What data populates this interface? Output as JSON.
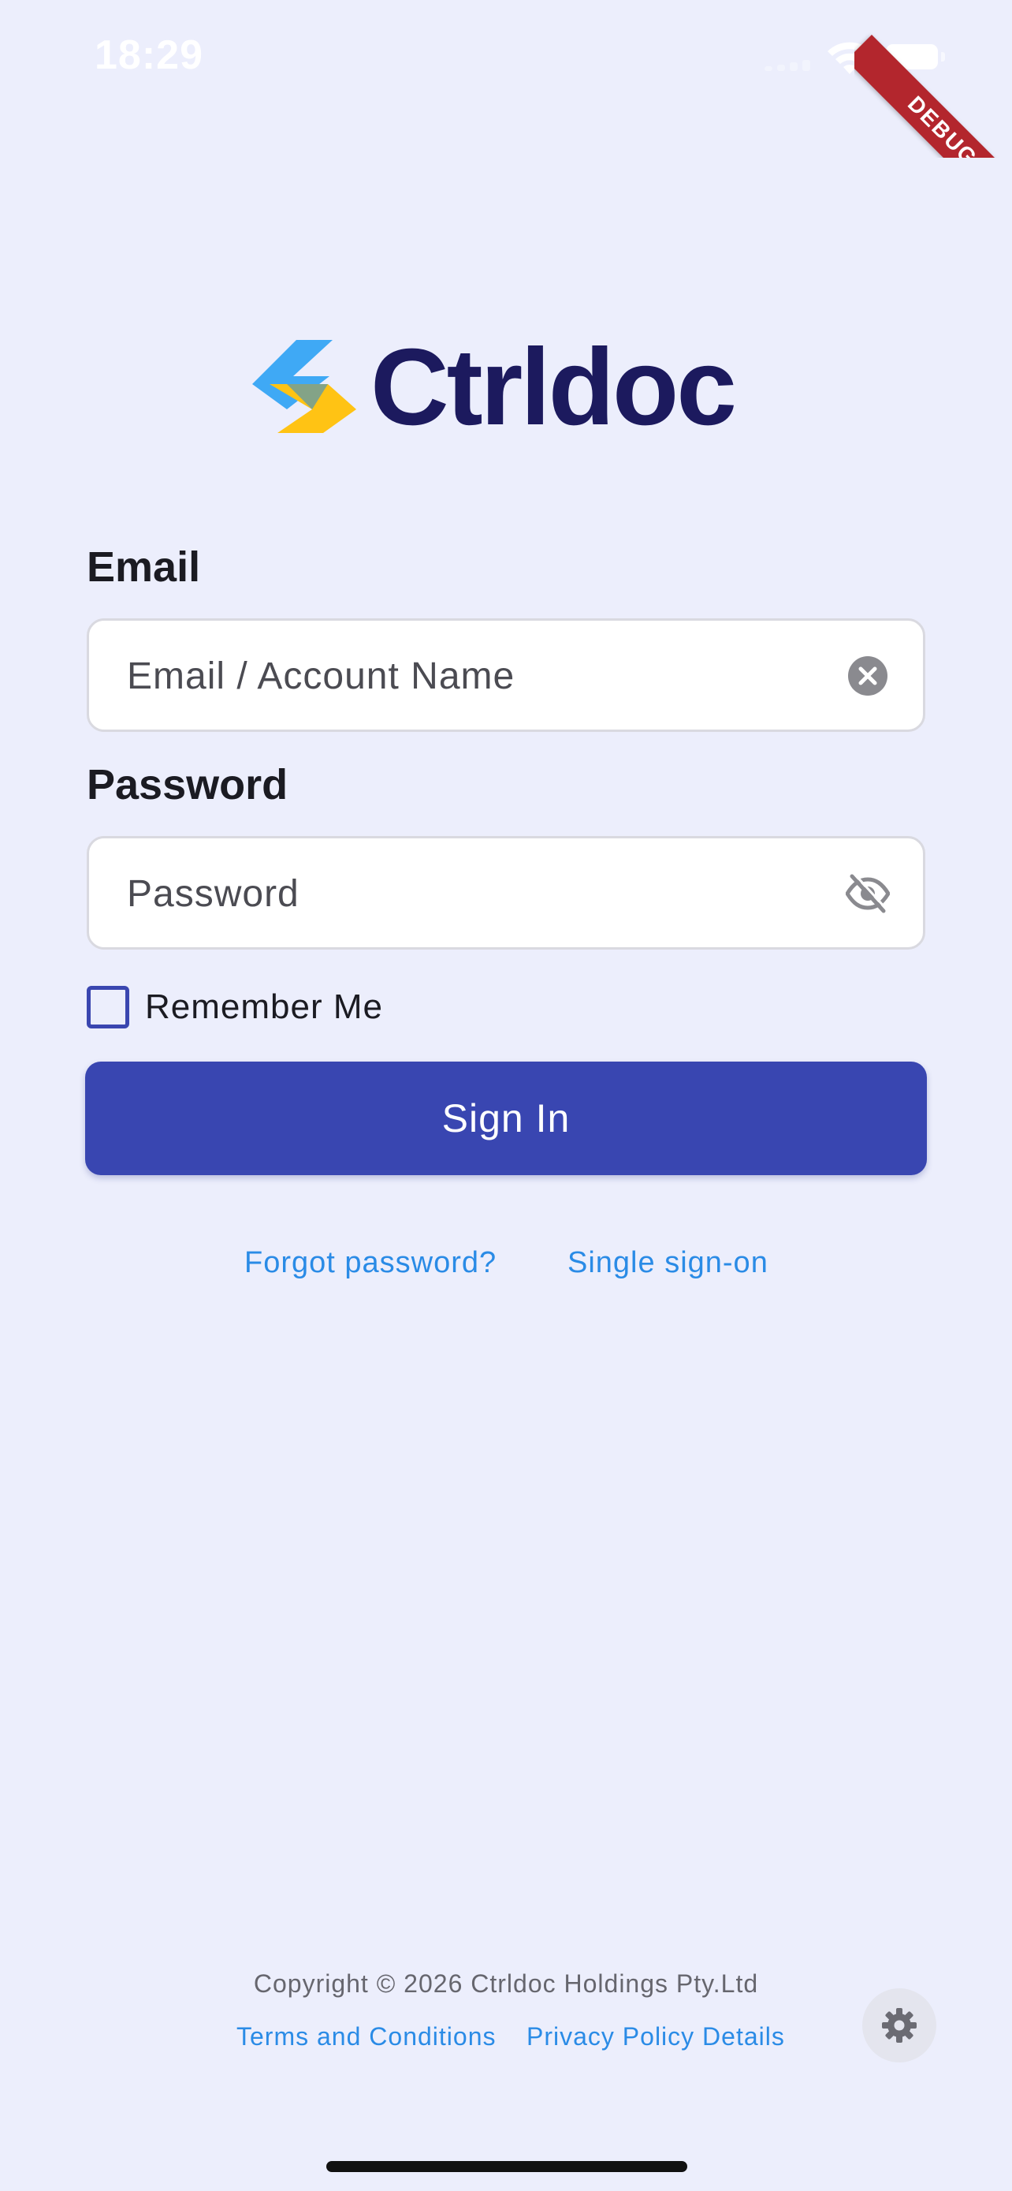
{
  "status_bar": {
    "time": "18:29"
  },
  "debug_ribbon": {
    "label": "DEBUG"
  },
  "brand": {
    "name": "Ctrldoc",
    "colors": {
      "wordmark": "#1c1a5e",
      "mark_blue": "#3fa9f5",
      "mark_yellow": "#ffc314"
    }
  },
  "form": {
    "email": {
      "label": "Email",
      "value": "",
      "placeholder": "Email / Account Name",
      "trailing_icon": "clear-icon"
    },
    "password": {
      "label": "Password",
      "value": "",
      "placeholder": "Password",
      "trailing_icon": "visibility-off-icon"
    },
    "remember_me": {
      "label": "Remember Me",
      "checked": false
    },
    "sign_in_label": "Sign In"
  },
  "links": {
    "forgot_password": "Forgot password?",
    "single_sign_on": "Single sign-on"
  },
  "footer": {
    "copyright": "Copyright © 2026 Ctrldoc Holdings Pty.Ltd",
    "terms": "Terms and Conditions",
    "privacy": "Privacy Policy Details",
    "settings_icon": "gear-icon"
  },
  "theme": {
    "background": "#eceefc",
    "primary": "#3946b1",
    "link": "#2a8be6"
  }
}
